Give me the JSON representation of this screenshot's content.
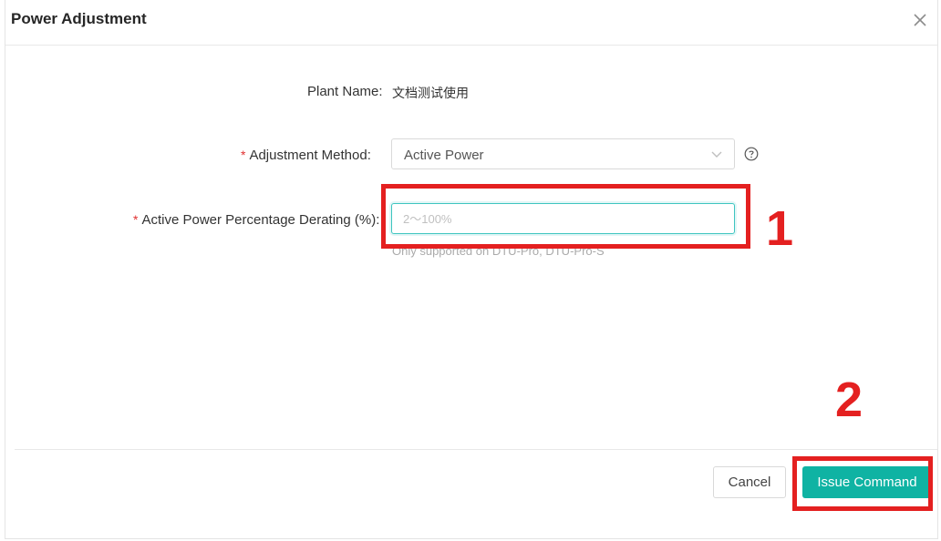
{
  "dialog": {
    "title": "Power Adjustment",
    "close_icon": "close-icon"
  },
  "form": {
    "plant_name_label": "Plant Name:",
    "plant_name_value": "文档测试使用",
    "required_mark": "*",
    "adjustment_method_label": "Adjustment Method:",
    "adjustment_method_value": "Active Power",
    "derating_label": "Active Power Percentage Derating (%):",
    "derating_placeholder": "2～100%",
    "derating_value": "",
    "derating_hint": "Only supported on DTU-Pro, DTU-Pro-S"
  },
  "footer": {
    "cancel_label": "Cancel",
    "issue_label": "Issue Command"
  },
  "annotations": {
    "marker_1": "1",
    "marker_2": "2"
  },
  "colors": {
    "primary": "#0fb3a3",
    "annotation": "#e42020",
    "required": "#e03030",
    "focus_border": "#3ec5c0"
  }
}
